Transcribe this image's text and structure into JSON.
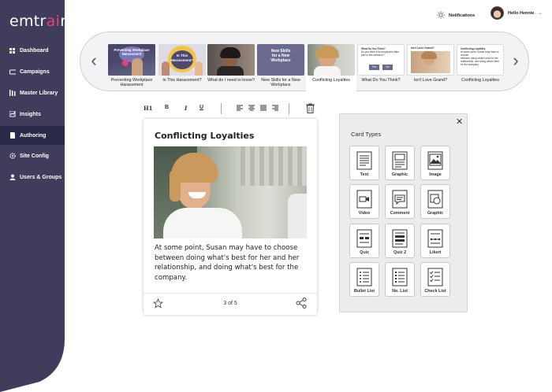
{
  "app": {
    "logo_prefix": "emtr",
    "logo_accent": "ai",
    "logo_suffix": "n",
    "brand_color": "#3f3d5b",
    "accent_color": "#e8407a"
  },
  "sidebar": {
    "items": [
      {
        "label": "Dashboard",
        "icon": "dashboard-icon",
        "active": false
      },
      {
        "label": "Campaigns",
        "icon": "campaigns-icon",
        "active": false
      },
      {
        "label": "Master Library",
        "icon": "library-icon",
        "active": false
      },
      {
        "label": "Insights",
        "icon": "insights-icon",
        "active": false
      },
      {
        "label": "Authoring",
        "icon": "authoring-icon",
        "active": true
      },
      {
        "label": "Site Config",
        "icon": "gear-icon",
        "active": false
      },
      {
        "label": "Users & Groups",
        "icon": "users-icon",
        "active": false
      }
    ]
  },
  "topbar": {
    "notifications_label": "Notifications",
    "greeting": "Hello Hennie"
  },
  "carousel": {
    "items": [
      {
        "caption": [
          "Preventing Workplace",
          "Harassment"
        ],
        "thumb_text": [
          "Preventing Workplace",
          "Harassment"
        ]
      },
      {
        "caption": [
          "Is This Harassment?"
        ],
        "thumb_text": [
          "Is This",
          "Harassment?"
        ]
      },
      {
        "caption": [
          "What do I need to know?"
        ],
        "thumb_text": []
      },
      {
        "caption": [
          "New Skills for a New",
          "Workplace"
        ],
        "thumb_text": [
          "New Skills",
          "for a New",
          "Workplace"
        ]
      },
      {
        "caption": [
          "Conflicting Loyalties"
        ],
        "thumb_text": [],
        "selected": true
      },
      {
        "caption": [
          "What Do You Think?"
        ],
        "thumb_text": [
          "What Do You Think?",
          "Do you think it be employees take",
          "part in this behavior?",
          "Yes",
          "No"
        ]
      },
      {
        "caption": [
          "Isn't Love Grand?"
        ],
        "thumb_text": [
          "Isn't Love Grand?"
        ]
      },
      {
        "caption": [
          "Conflicting Loyalties"
        ],
        "thumb_text": [
          "Conflicting Loyalties",
          "At some point, Susan may have to choose",
          "between doing what's best for her",
          "relationship, and doing what's best",
          "for the company."
        ]
      }
    ]
  },
  "toolbar": {
    "h1": "H1",
    "bold": "B",
    "italic": "I",
    "underline": "U"
  },
  "card": {
    "title": "Conflicting Loyalties",
    "body": "At some point, Susan may have to choose between doing what's best for her and her relationship, and doing what's best for the company.",
    "pager": "3 of 5"
  },
  "card_types": {
    "title": "Card Types",
    "items": [
      {
        "label": "Text",
        "icon": "text-icon"
      },
      {
        "label": "Graphic",
        "icon": "graphic-text-icon"
      },
      {
        "label": "Image",
        "icon": "image-icon"
      },
      {
        "label": "Video",
        "icon": "video-icon"
      },
      {
        "label": "Comment",
        "icon": "comment-icon"
      },
      {
        "label": "Graphic",
        "icon": "graphic-icon"
      },
      {
        "label": "Quiz",
        "icon": "quiz-icon"
      },
      {
        "label": "Quiz 2",
        "icon": "quiz2-icon"
      },
      {
        "label": "Likert",
        "icon": "likert-icon"
      },
      {
        "label": "Bullet List",
        "icon": "bullet-list-icon"
      },
      {
        "label": "No. List",
        "icon": "numbered-list-icon"
      },
      {
        "label": "Check List",
        "icon": "check-list-icon"
      }
    ]
  }
}
